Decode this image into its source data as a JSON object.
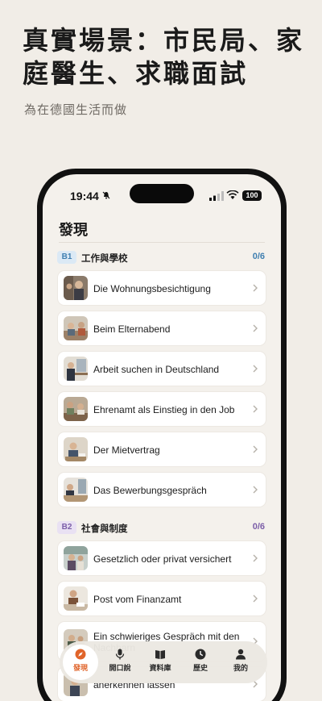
{
  "promo": {
    "title": "真實場景：市民局、家庭醫生、求職面試",
    "subtitle": "為在德國生活而做"
  },
  "status_bar": {
    "time": "19:44",
    "battery": "100"
  },
  "page": {
    "title": "發現"
  },
  "sections": [
    {
      "level": "B1",
      "title": "工作與學校",
      "count": "0/6",
      "accent": "#3f7fb0",
      "badge_bg": "#dbe9f5",
      "items": [
        {
          "label": "Die Wohnungsbesichtigung"
        },
        {
          "label": "Beim Elternabend"
        },
        {
          "label": "Arbeit suchen in Deutschland"
        },
        {
          "label": "Ehrenamt als Einstieg in den Job"
        },
        {
          "label": "Der Mietvertrag"
        },
        {
          "label": "Das Bewerbungsgespräch"
        }
      ]
    },
    {
      "level": "B2",
      "title": "社會與制度",
      "count": "0/6",
      "accent": "#7b5ea8",
      "badge_bg": "#e9e1f3",
      "items": [
        {
          "label": "Gesetzlich oder privat versichert"
        },
        {
          "label": "Post vom Finanzamt"
        },
        {
          "label": "Ein schwieriges Gespräch mit den Nachbarn"
        },
        {
          "label": "anerkennen lassen"
        }
      ]
    }
  ],
  "tabbar": {
    "tabs": [
      {
        "label": "發現",
        "icon": "compass-icon",
        "active": true
      },
      {
        "label": "開口說",
        "icon": "microphone-icon",
        "active": false
      },
      {
        "label": "資料庫",
        "icon": "book-icon",
        "active": false
      },
      {
        "label": "歷史",
        "icon": "clock-icon",
        "active": false
      },
      {
        "label": "我的",
        "icon": "person-icon",
        "active": false
      }
    ]
  },
  "colors": {
    "background": "#f1ede7",
    "active_tab": "#e0642a"
  }
}
